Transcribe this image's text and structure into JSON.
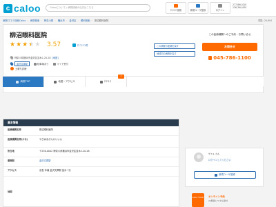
{
  "header": {
    "logo_mark": "c",
    "logo_text": "caloo",
    "search_placeholder": "Calooについて / 病院検索の仕方はこちら",
    "buttons": [
      {
        "label": "口コミ投稿",
        "color": "#ff6a00"
      },
      {
        "label": "新規ユーザ登録",
        "color": "#2b79c2"
      },
      {
        "label": "ログイン",
        "color": "#888888"
      }
    ],
    "stats": [
      "277,890,020",
      "136,390,000"
    ]
  },
  "breadcrumb": {
    "items": [
      "病院口コミ検索Caloo",
      "病院検索",
      "神奈川県",
      "横浜市",
      "金沢区",
      "眼科検索",
      "柳沼眼科医院"
    ],
    "views": "閲覧: 26,894"
  },
  "clinic": {
    "name": "柳沼眼科医院",
    "rating": 3.57,
    "score_text": "3.57",
    "review_link": "口コミ3件",
    "address": "神奈川県横浜市金沢区並木2-20-28",
    "address_link": "[地図]",
    "tags": [
      "金沢文庫駅"
    ],
    "chips": [
      "駐車場あり",
      "マイナ受付"
    ],
    "hours": "土曜も診療",
    "side_links": [
      "この病院の医師を探す",
      "地域内の病院を探す"
    ]
  },
  "cta": {
    "heading": "この医療機関へのご予約・お問い合せ",
    "button": "お問合せ",
    "phone": "045-786-1100"
  },
  "tabs": [
    {
      "label": "病院TOP",
      "active": true
    },
    {
      "label": "地図・アクセス",
      "active": false
    },
    {
      "label": "口コミ",
      "active": false,
      "badge": "3"
    }
  ],
  "basic_info": {
    "title": "基本情報",
    "rows": [
      {
        "key": "医療機関名称",
        "value": "柳沼眼科医院"
      },
      {
        "key": "医療機関名称(かな)",
        "value": "やぎぬまがんかいいん"
      },
      {
        "key": "所在地",
        "value": "〒236-0042 神奈川県横浜市金沢区並木2-20-28"
      },
      {
        "key": "最寄駅",
        "value": "金沢文庫駅",
        "link": true
      },
      {
        "key": "アクセス",
        "value": "京急 本線 金沢文庫駅 徒歩 7分"
      },
      {
        "key": "地図",
        "value": ""
      }
    ]
  },
  "guest": {
    "name": "ゲスト",
    "name_suffix": "さん",
    "login": "ログインしてください",
    "register": "新規ユーザ登録"
  },
  "promo": {
    "badge": "Caloo TOPIC",
    "title": "オンライン予約",
    "sub": "24時間いつでも受付"
  }
}
